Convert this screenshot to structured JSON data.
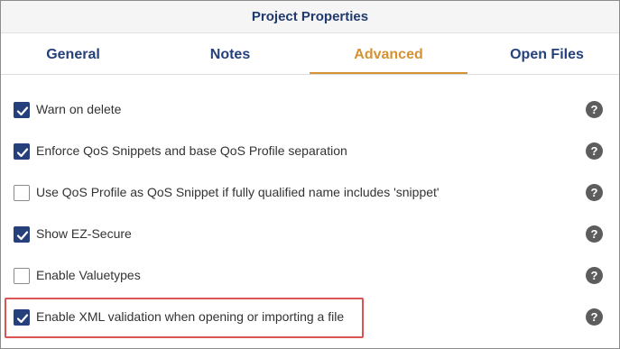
{
  "dialog": {
    "title": "Project Properties"
  },
  "tabs": [
    {
      "label": "General",
      "active": false
    },
    {
      "label": "Notes",
      "active": false
    },
    {
      "label": "Advanced",
      "active": true
    },
    {
      "label": "Open Files",
      "active": false
    }
  ],
  "options": [
    {
      "label": "Warn on delete",
      "checked": true
    },
    {
      "label": "Enforce QoS Snippets and base QoS Profile separation",
      "checked": true
    },
    {
      "label": "Use QoS Profile as QoS Snippet if fully qualified name includes 'snippet'",
      "checked": false
    },
    {
      "label": "Show EZ-Secure",
      "checked": true
    },
    {
      "label": "Enable Valuetypes",
      "checked": false
    },
    {
      "label": "Enable XML validation when opening or importing a file",
      "checked": true,
      "highlighted": true
    }
  ],
  "help_glyph": "?",
  "icons": {
    "checkmark": "check-icon",
    "help": "help-icon"
  },
  "colors": {
    "accent_tab": "#d49233",
    "tab_text": "#25407a",
    "checkbox_fill": "#25407a",
    "help_bg": "#5d5d5d",
    "highlight": "#d95454"
  }
}
